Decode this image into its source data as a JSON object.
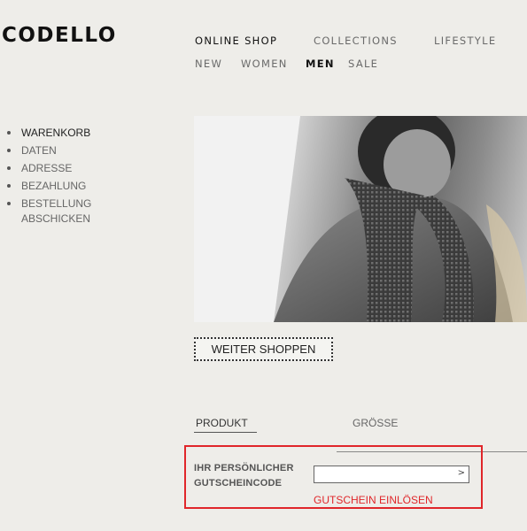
{
  "brand": {
    "logo": "CODELLO"
  },
  "nav": {
    "top": [
      "ONLINE SHOP",
      "COLLECTIONS",
      "LIFESTYLE"
    ],
    "sub": [
      "NEW",
      "WOMEN",
      "MEN",
      "SALE"
    ],
    "active_sub": "MEN"
  },
  "checkout_steps": {
    "items": [
      "WARENKORB",
      "DATEN",
      "ADRESSE",
      "BEZAHLUNG"
    ],
    "last_line1": "BESTELLUNG",
    "last_line2": "ABSCHICKEN",
    "active": "WARENKORB"
  },
  "main": {
    "continue_button": "WEITER SHOPPEN",
    "columns": {
      "product": "PRODUKT",
      "size": "GRÖSSE"
    }
  },
  "voucher": {
    "label_line1": "IHR PERSÖNLICHER",
    "label_line2": "GUTSCHEINCODE",
    "input_value": "",
    "input_arrow": ">",
    "redeem_link": "GUTSCHEIN EINLÖSEN"
  },
  "colors": {
    "background": "#eeede9",
    "highlight": "#e0262a"
  }
}
